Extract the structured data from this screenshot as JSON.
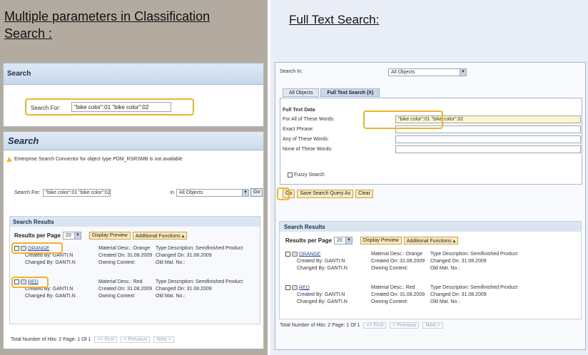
{
  "left": {
    "title_line1": "Multiple parameters in Classification",
    "title_line2": "Search :",
    "box1": {
      "header": "Search",
      "search_label": "Search For:",
      "search_value": "\"bike color\":01 \"bike color\":02"
    },
    "box2": {
      "header": "Search",
      "warning": "Enterprise Search Connector for object type PDM_RSRSMB is not available",
      "search_label": "Search For:",
      "search_value": "\"bike color\":01 \"bike color\":02",
      "in_label": "in",
      "in_value": "All Objects",
      "go": "Go",
      "results_header": "Search Results",
      "rpp_label": "Results per Page",
      "rpp_value": "20",
      "display_preview": "Display Preview",
      "additional_functions": "Additional Functions ▴",
      "pager": {
        "total": "Total Number of Hits: 2 Page: 1 Of 1",
        "first": "<< First",
        "previous": "< Previous",
        "next": "Next >"
      }
    },
    "results": [
      {
        "name": "ORANGE",
        "created_by": "Created By: GANTI.N",
        "created_on": "Created On: 31.08.2009",
        "changed_by": "Changed By: GANTI.N",
        "owning_context": "Owning Context:",
        "material_desc": "Material Desc.: Orange",
        "changed_on": "Changed On: 31.08.2009",
        "old_mat": "Old Mat. No.:",
        "type_desc": "Type Description: Semifinished Product"
      },
      {
        "name": "RED",
        "created_by": "Created By: GANTI.N",
        "created_on": "Created On: 31.08.2009",
        "changed_by": "Changed By: GANTI.N",
        "owning_context": "Owning Context:",
        "material_desc": "Material Desc.: Red",
        "changed_on": "Changed On: 31.08.2009",
        "old_mat": "Old Mat. No.:",
        "type_desc": "Type Description: Semifinished Product"
      }
    ]
  },
  "right": {
    "title": "Full Text Search:",
    "search_in_label": "Search In:",
    "search_in_value": "All Objects",
    "tabs": [
      "All Objects",
      "Full Text Search (X)"
    ],
    "ftd_header": "Full Text Data",
    "fields": [
      {
        "label": "For All of These Words:",
        "value": "\"bike color\":01 \"bike color\":02"
      },
      {
        "label": "Exact Phrase:",
        "value": ""
      },
      {
        "label": "Any of These Words:",
        "value": ""
      },
      {
        "label": "None of These Words:",
        "value": ""
      }
    ],
    "fuzzy": "Fuzzy Search",
    "actions": {
      "go": "Go",
      "save": "Save Search Query As",
      "clear": "Clear"
    },
    "results_header": "Search Results",
    "rpp_label": "Results per Page",
    "rpp_value": "20",
    "display_preview": "Display Preview",
    "additional_functions": "Additional Functions ▴",
    "pager": {
      "total": "Total Number of Hits: 2 Page: 1 Of 1",
      "first": "<< First",
      "previous": "< Previous",
      "next": "Next >"
    }
  },
  "colors": {
    "highlight": "#f0b428",
    "left_background": "#b3aba0",
    "right_background": "#e8edf6",
    "header_blue": "#dbe5f1"
  }
}
